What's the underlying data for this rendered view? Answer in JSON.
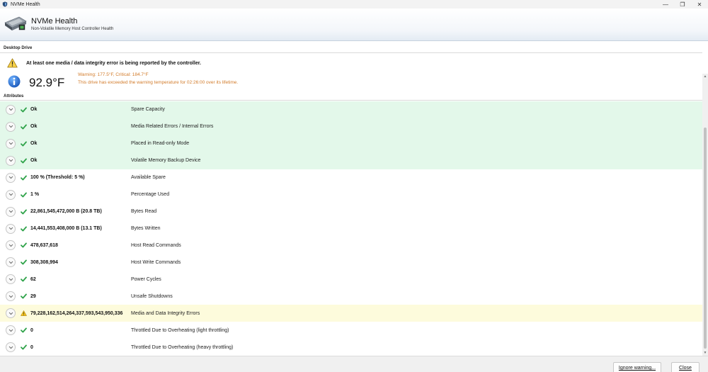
{
  "window": {
    "title": "NVMe Health",
    "minimize": "—",
    "maximize": "❐",
    "close": "✕"
  },
  "header": {
    "title": "NVMe Health",
    "subtitle": "Non-Volatile Memory Host Controller Health"
  },
  "sections": {
    "drive": "Desktop Drive",
    "attributes": "Attributes"
  },
  "warning": {
    "message": "At least one media / data integrity error is being reported by the controller."
  },
  "temperature": {
    "value": "92.9°F",
    "thresholds": "Warning: 177.5°F, Critical: 184.7°F",
    "message": "This drive has exceeded the warning temperature for 02:26:00 over its lifetime."
  },
  "attributes": [
    {
      "value": "Ok",
      "name": "Spare Capacity",
      "status": "ok",
      "highlight": "green"
    },
    {
      "value": "Ok",
      "name": "Media Related Errors / Internal Errors",
      "status": "ok",
      "highlight": "green"
    },
    {
      "value": "Ok",
      "name": "Placed in Read-only Mode",
      "status": "ok",
      "highlight": "green"
    },
    {
      "value": "Ok",
      "name": "Volatile Memory Backup Device",
      "status": "ok",
      "highlight": "green"
    },
    {
      "value": "100 % (Threshold: 5 %)",
      "name": "Available Spare",
      "status": "ok",
      "highlight": "none"
    },
    {
      "value": "1 %",
      "name": "Percentage Used",
      "status": "ok",
      "highlight": "none"
    },
    {
      "value": "22,861,545,472,000 B (20.8 TB)",
      "name": "Bytes Read",
      "status": "ok",
      "highlight": "none"
    },
    {
      "value": "14,441,553,408,000 B (13.1 TB)",
      "name": "Bytes Written",
      "status": "ok",
      "highlight": "none"
    },
    {
      "value": "478,637,618",
      "name": "Host Read Commands",
      "status": "ok",
      "highlight": "none"
    },
    {
      "value": "308,308,994",
      "name": "Host Write Commands",
      "status": "ok",
      "highlight": "none"
    },
    {
      "value": "62",
      "name": "Power Cycles",
      "status": "ok",
      "highlight": "none"
    },
    {
      "value": "29",
      "name": "Unsafe Shutdowns",
      "status": "ok",
      "highlight": "none"
    },
    {
      "value": "79,228,162,514,264,337,593,543,950,336",
      "name": "Media and Data Integrity Errors",
      "status": "warning",
      "highlight": "yellow"
    },
    {
      "value": "0",
      "name": "Throttled Due to Overheating (light throttling)",
      "status": "ok",
      "highlight": "none"
    },
    {
      "value": "0",
      "name": "Throttled Due to Overheating (heavy throttling)",
      "status": "ok",
      "highlight": "none"
    }
  ],
  "buttons": {
    "ignore": "Ignore warning...",
    "close": "Close"
  },
  "colors": {
    "ok_green": "#2fa34a",
    "warning_yellow": "#f2c21a",
    "info_blue": "#1f6fd1",
    "temp_orange": "#d27b2a",
    "row_green": "#e3f8ea",
    "row_yellow": "#fdfbdc"
  }
}
